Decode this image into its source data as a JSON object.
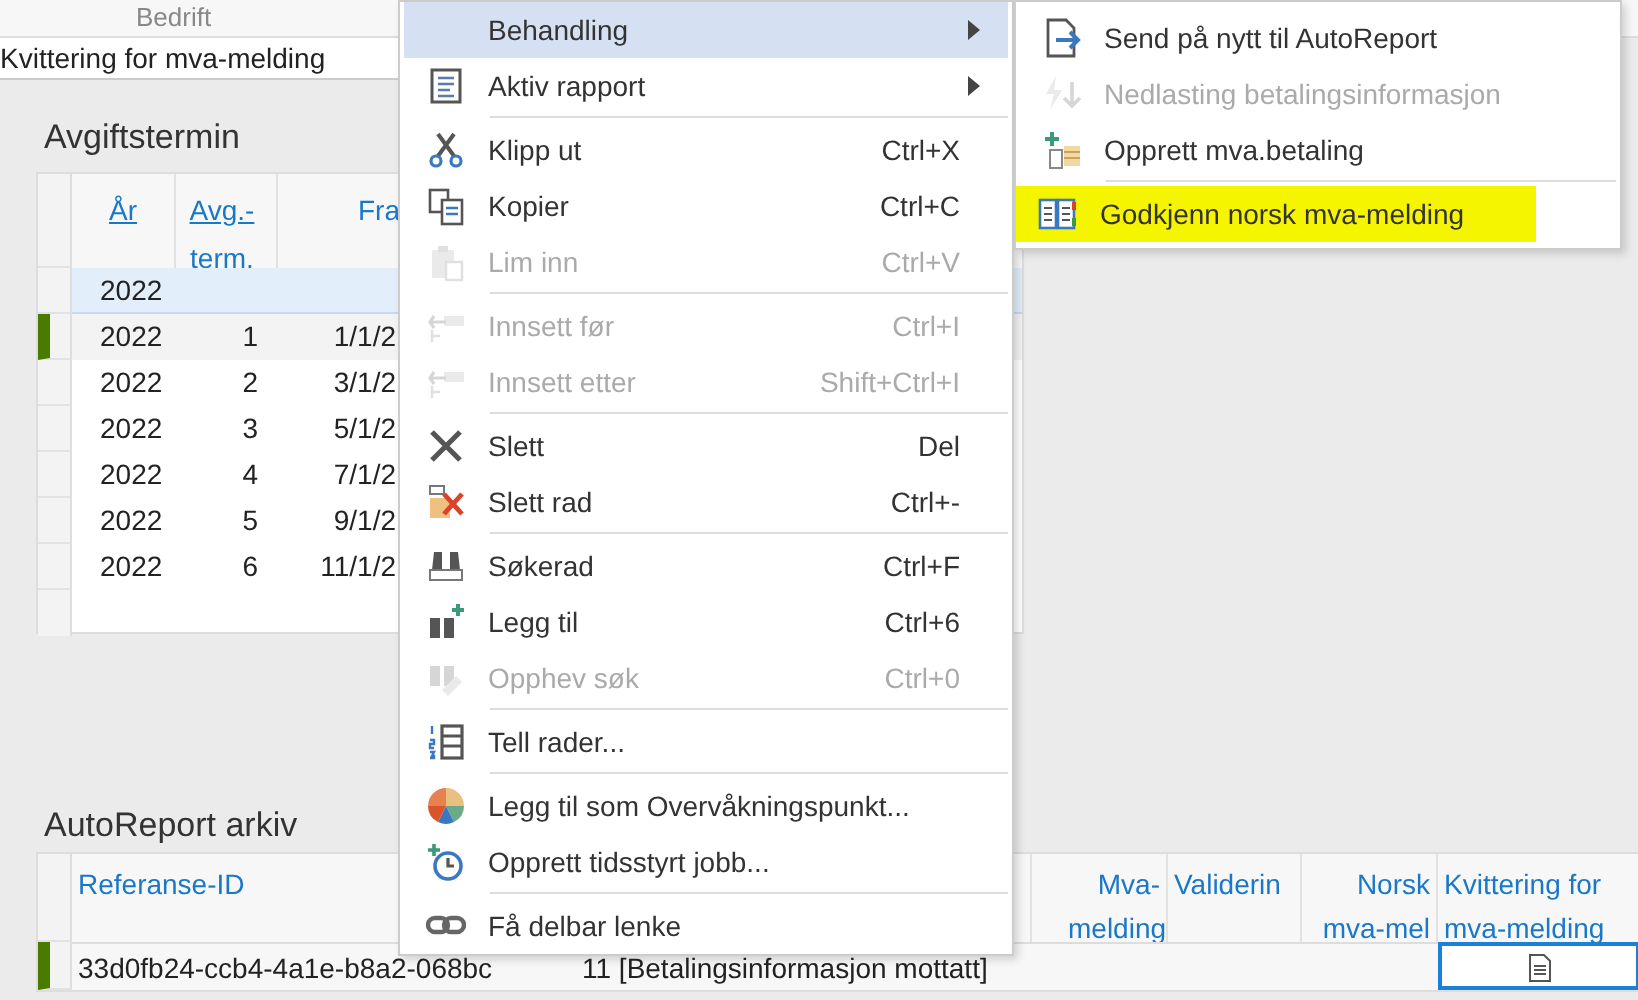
{
  "header": {
    "column_title": "Bedrift",
    "field_value": "Kvittering for mva-melding"
  },
  "avgiftstermin": {
    "title": "Avgiftstermin",
    "columns": [
      {
        "label": "År",
        "link": true
      },
      {
        "label": "Avg.-term.",
        "link": true
      },
      {
        "label": "Fra",
        "link": false
      }
    ],
    "new_row": {
      "cells": [
        "2022"
      ]
    },
    "rows": [
      {
        "cells": [
          "2022",
          "1",
          "1/1/2"
        ],
        "current": true
      },
      {
        "cells": [
          "2022",
          "2",
          "3/1/2"
        ],
        "current": false
      },
      {
        "cells": [
          "2022",
          "3",
          "5/1/2"
        ],
        "current": false
      },
      {
        "cells": [
          "2022",
          "4",
          "7/1/2"
        ],
        "current": false
      },
      {
        "cells": [
          "2022",
          "5",
          "9/1/2"
        ],
        "current": false
      },
      {
        "cells": [
          "2022",
          "6",
          "11/1/2"
        ],
        "current": false
      }
    ]
  },
  "autoreport": {
    "title": "AutoReport arkiv",
    "columns": [
      "Referanse-ID",
      "",
      "Mva-melding",
      "Validerin",
      "Norsk mva-mel",
      "Kvittering for mva-melding"
    ],
    "rows": [
      {
        "cells": [
          {
            "text": "33d0fb24-ccb4-4a1e-b8a2-068bc",
            "selected": false
          },
          {
            "text": "11 [Betalingsinformasjon mottatt]",
            "selected": false
          },
          {
            "selected": false
          },
          {
            "selected": false
          },
          {
            "selected": false
          },
          {
            "selected": true
          }
        ],
        "current": true
      }
    ]
  },
  "context_menu": {
    "items": [
      {
        "label": "Behandling",
        "submenu": true,
        "highlighted": true,
        "disabled": false,
        "separator_after": false
      },
      {
        "label": "Aktiv rapport",
        "submenu": true,
        "highlighted": false,
        "disabled": false,
        "separator_after": true
      },
      {
        "label": "Klipp ut",
        "shortcut": "Ctrl+X",
        "highlighted": false,
        "disabled": false,
        "separator_after": false
      },
      {
        "label": "Kopier",
        "shortcut": "Ctrl+C",
        "highlighted": false,
        "disabled": false,
        "separator_after": false
      },
      {
        "label": "Lim inn",
        "shortcut": "Ctrl+V",
        "highlighted": false,
        "disabled": true,
        "separator_after": true
      },
      {
        "label": "Innsett før",
        "shortcut": "Ctrl+I",
        "highlighted": false,
        "disabled": true,
        "separator_after": false
      },
      {
        "label": "Innsett etter",
        "shortcut": "Shift+Ctrl+I",
        "highlighted": false,
        "disabled": true,
        "separator_after": true
      },
      {
        "label": "Slett",
        "shortcut": "Del",
        "highlighted": false,
        "disabled": false,
        "separator_after": false
      },
      {
        "label": "Slett rad",
        "shortcut": "Ctrl+-",
        "highlighted": false,
        "disabled": false,
        "separator_after": true
      },
      {
        "label": "Søkerad",
        "shortcut": "Ctrl+F",
        "highlighted": false,
        "disabled": false,
        "separator_after": false
      },
      {
        "label": "Legg til",
        "shortcut": "Ctrl+6",
        "highlighted": false,
        "disabled": false,
        "separator_after": false
      },
      {
        "label": "Opphev søk",
        "shortcut": "Ctrl+0",
        "highlighted": false,
        "disabled": true,
        "separator_after": true
      },
      {
        "label": "Tell rader...",
        "highlighted": false,
        "disabled": false,
        "separator_after": true
      },
      {
        "label": "Legg til som Overvåkningspunkt...",
        "highlighted": false,
        "disabled": false,
        "separator_after": false
      },
      {
        "label": "Opprett tidsstyrt jobb...",
        "highlighted": false,
        "disabled": false,
        "separator_after": true
      },
      {
        "label": "Få delbar lenke",
        "highlighted": false,
        "disabled": false,
        "separator_after": false
      }
    ]
  },
  "submenu": {
    "items": [
      {
        "label": "Send på nytt til AutoReport",
        "disabled": false,
        "marked": false,
        "separator_after": false
      },
      {
        "label": "Nedlasting betalingsinformasjon",
        "disabled": true,
        "marked": false,
        "separator_after": false
      },
      {
        "label": "Opprett mva.betaling",
        "disabled": false,
        "marked": false,
        "separator_after": true
      },
      {
        "label": "Godkjenn norsk mva-melding",
        "disabled": false,
        "marked": true,
        "separator_after": false
      }
    ]
  }
}
